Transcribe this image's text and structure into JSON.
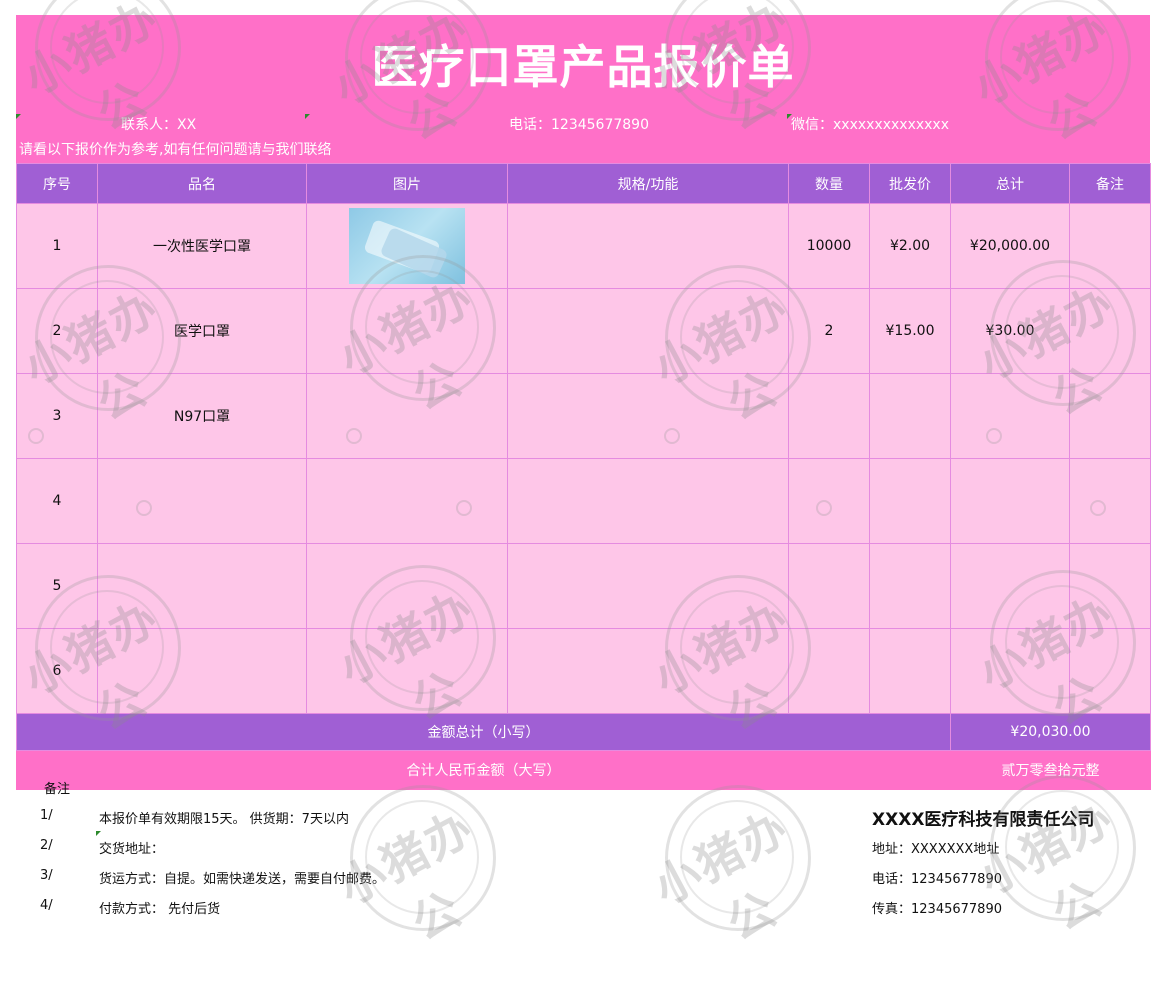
{
  "title": "医疗口罩产品报价单",
  "contact": {
    "person": "联系人：XX",
    "phone": "电话：12345677890",
    "wechat": "微信：xxxxxxxxxxxxxx"
  },
  "intro": "请看以下报价作为参考,如有任何问题请与我们联络",
  "table": {
    "headers": [
      "序号",
      "品名",
      "图片",
      "规格/功能",
      "数量",
      "批发价",
      "总计",
      "备注"
    ],
    "rows": [
      {
        "no": "1",
        "name": "一次性医学口罩",
        "spec": "",
        "qty": "10000",
        "price": "¥2.00",
        "total": "¥20,000.00",
        "note": ""
      },
      {
        "no": "2",
        "name": "医学口罩",
        "spec": "",
        "qty": "2",
        "price": "¥15.00",
        "total": "¥30.00",
        "note": ""
      },
      {
        "no": "3",
        "name": "N97口罩",
        "spec": "",
        "qty": "",
        "price": "",
        "total": "",
        "note": ""
      },
      {
        "no": "4",
        "name": "",
        "spec": "",
        "qty": "",
        "price": "",
        "total": "",
        "note": ""
      },
      {
        "no": "5",
        "name": "",
        "spec": "",
        "qty": "",
        "price": "",
        "total": "",
        "note": ""
      },
      {
        "no": "6",
        "name": "",
        "spec": "",
        "qty": "",
        "price": "",
        "total": "",
        "note": ""
      }
    ],
    "sum_label": "金额总计（小写）",
    "sum_value": "¥20,030.00",
    "cap_label": "合计人民币金额（大写）",
    "cap_value": "贰万零叁拾元整"
  },
  "remarks": {
    "label": "备注",
    "items": [
      {
        "idx": "1/",
        "text": "本报价单有效期限15天。   供货期：7天以内"
      },
      {
        "idx": "2/",
        "text": "交货地址："
      },
      {
        "idx": "3/",
        "text": "货运方式：自提。如需快递发送，需要自付邮费。"
      },
      {
        "idx": "4/",
        "text": "付款方式：  先付后货"
      }
    ]
  },
  "company": {
    "name": "XXXX医疗科技有限责任公司",
    "address": "地址：XXXXXXX地址",
    "phone": "电话：12345677890",
    "fax": "传真：12345677890"
  },
  "watermark": "小猪办公",
  "colors": {
    "header_pink": "#ff70c8",
    "header_purple": "#a05fd4",
    "row_pink": "#fec6e8"
  }
}
